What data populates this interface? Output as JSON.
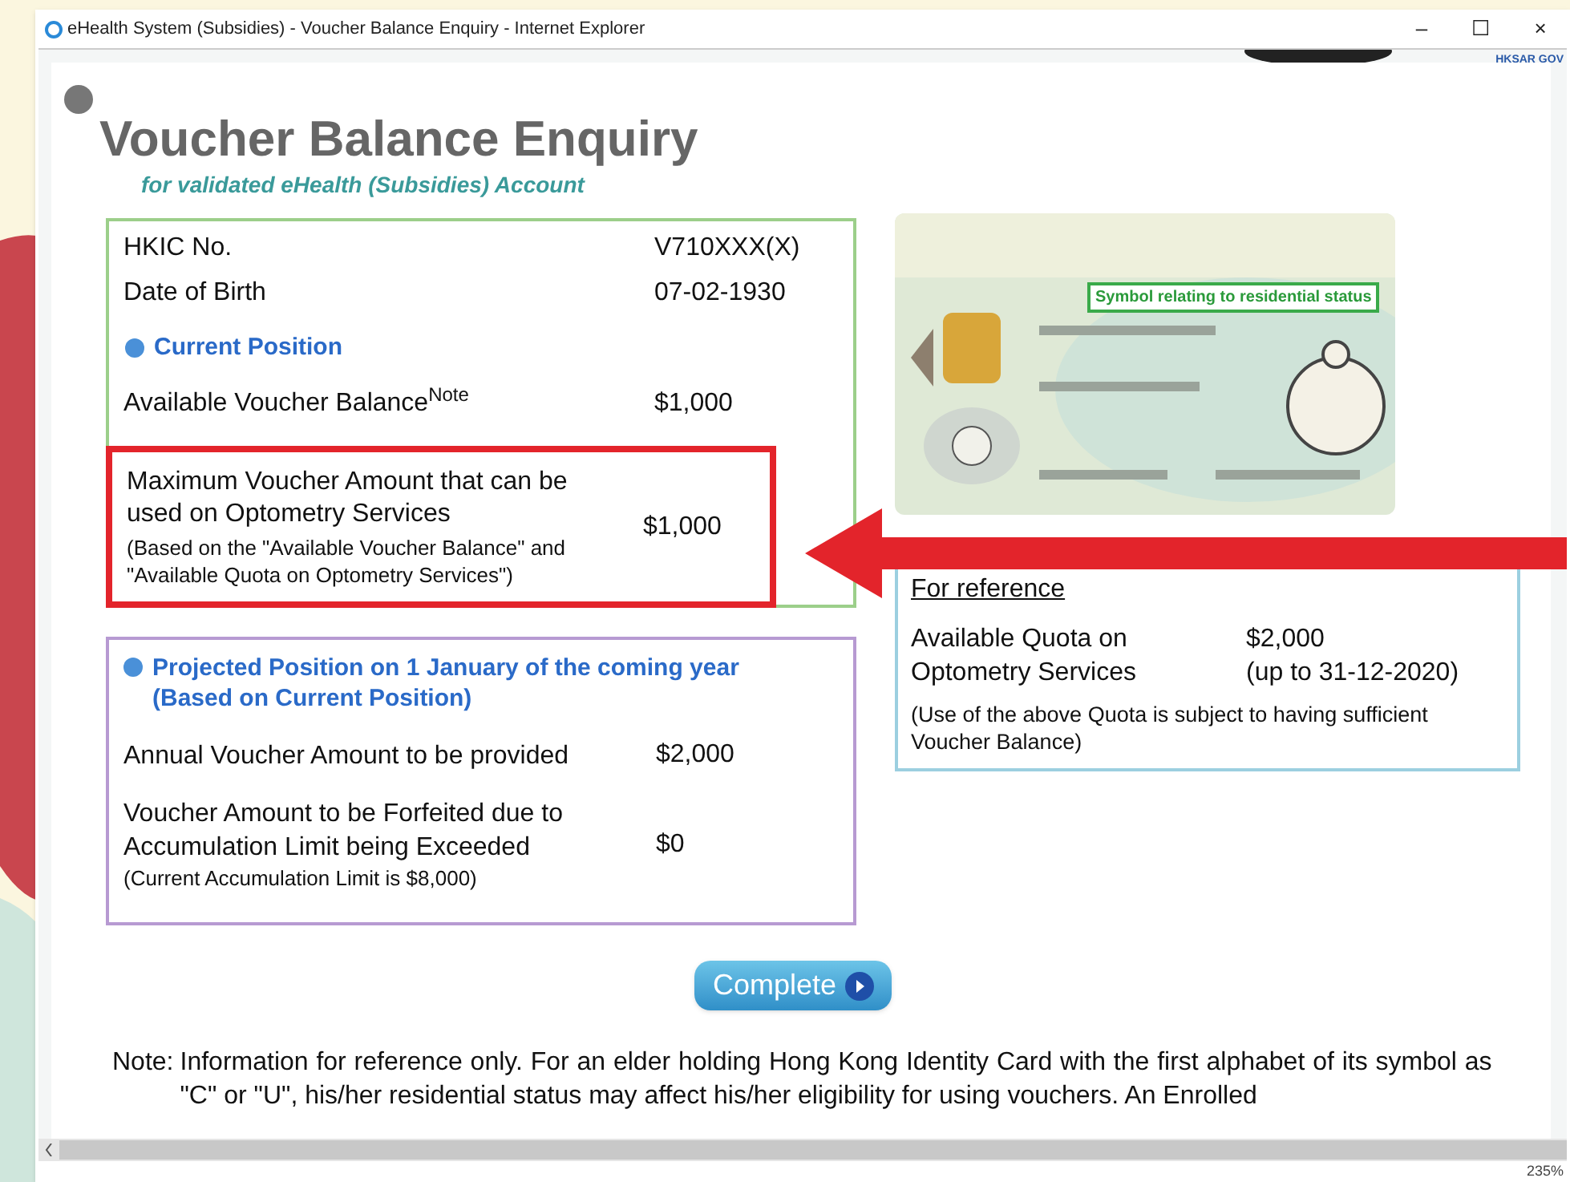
{
  "window": {
    "title": "eHealth System (Subsidies) - Voucher Balance Enquiry - Internet Explorer",
    "controls": [
      "–",
      "☐",
      "×"
    ]
  },
  "header": {
    "agency": "HKSAR GOV"
  },
  "page": {
    "title": "Voucher Balance Enquiry",
    "subtitle": "for validated eHealth (Subsidies) Account"
  },
  "account": {
    "rows": [
      {
        "label": "HKIC No.",
        "value": "V710XXX(X)"
      },
      {
        "label": "Date of Birth",
        "value": "07-02-1930"
      }
    ],
    "current_heading": "Current Position",
    "balance": {
      "label": "Available Voucher Balance$^{Note}$",
      "value": "$1,000"
    },
    "maximum": {
      "label": "Maximum Voucher Amount that can be used on Optometry Services",
      "note": "(Based on the \"Available Voucher Balance\" and \"Available Quota on Optometry Services\")",
      "value": "$1,000",
      "highlighted": true
    }
  },
  "projected": {
    "heading": "Projected Position on 1 January of the coming year",
    "subheading": "(Based on Current Position)",
    "rows": [
      {
        "label": "Annual Voucher Amount to be provided",
        "value": "$2,000"
      },
      {
        "label": "Voucher Amount to be Forfeited due to Accumulation Limit being Exceeded",
        "note": "(Current Accumulation Limit is $8,000)",
        "value": "$0"
      }
    ]
  },
  "id_card": {
    "callout": "Symbol relating to residential status"
  },
  "reference": {
    "heading": "For reference",
    "label": "Available Quota on Optometry Services",
    "value": "$2,000",
    "until": "(up to 31-12-2020)",
    "note": "(Use of the above Quota is subject to having sufficient Voucher Balance)"
  },
  "complete_button": "Complete",
  "note": {
    "label": "Note:",
    "text": "Information for reference only. For an elder holding Hong Kong Identity Card with the first alphabet of its symbol as \"C\" or \"U\", his/her residential status may affect his/her eligibility for using vouchers. An Enrolled"
  },
  "status_bar": {
    "zoom": "235%"
  }
}
